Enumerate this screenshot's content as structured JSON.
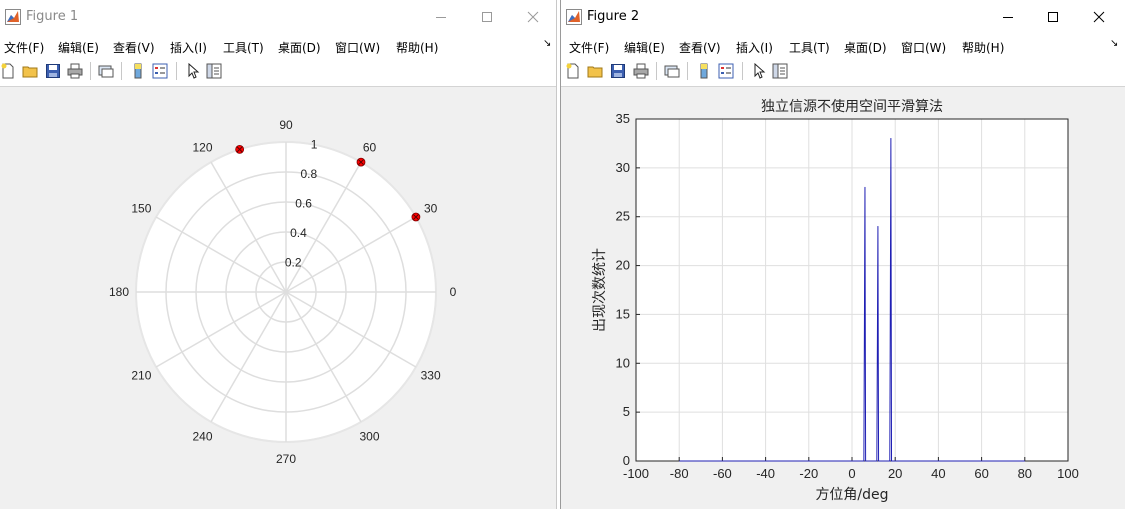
{
  "figure1": {
    "title": "Figure 1",
    "menu": [
      "文件(F)",
      "编辑(E)",
      "查看(V)",
      "插入(I)",
      "工具(T)",
      "桌面(D)",
      "窗口(W)",
      "帮助(H)"
    ],
    "polar": {
      "angle_labels": [
        "0",
        "30",
        "60",
        "90",
        "120",
        "150",
        "180",
        "210",
        "240",
        "270",
        "300",
        "330"
      ],
      "radial_labels": [
        "0.2",
        "0.4",
        "0.6",
        "0.8",
        "1"
      ],
      "points": [
        {
          "angle_deg": 30,
          "r": 1
        },
        {
          "angle_deg": 60,
          "r": 1
        },
        {
          "angle_deg": 108,
          "r": 1
        }
      ],
      "marker_color": "#ff0000"
    }
  },
  "figure2": {
    "title": "Figure 2",
    "menu": [
      "文件(F)",
      "编辑(E)",
      "查看(V)",
      "插入(I)",
      "工具(T)",
      "桌面(D)",
      "窗口(W)",
      "帮助(H)"
    ]
  },
  "chart_data": {
    "type": "line",
    "title": "独立信源不使用空间平滑算法",
    "xlabel": "方位角/deg",
    "ylabel": "出现次数统计",
    "xlim": [
      -100,
      100
    ],
    "ylim": [
      0,
      35
    ],
    "xticks": [
      "-100",
      "-80",
      "-60",
      "-40",
      "-20",
      "0",
      "20",
      "40",
      "60",
      "80",
      "100"
    ],
    "yticks": [
      "0",
      "5",
      "10",
      "15",
      "20",
      "25",
      "30",
      "35"
    ],
    "grid": true,
    "line_color": "#1f1fb4",
    "baseline_range": [
      -80,
      80
    ],
    "peaks": [
      {
        "x": 6,
        "y": 28
      },
      {
        "x": 12,
        "y": 24
      },
      {
        "x": 18,
        "y": 33
      }
    ]
  }
}
